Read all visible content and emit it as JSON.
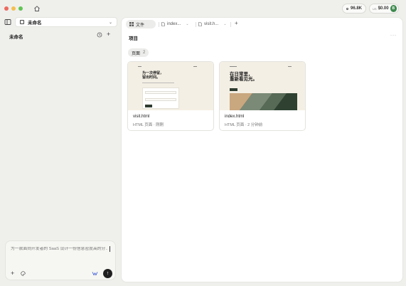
{
  "titlebar": {
    "github_stars": "96.8K",
    "cost": "$0.00",
    "cost_currency": "US",
    "avatar_initial": "B"
  },
  "sidebar": {
    "project_name": "未命名",
    "session_title": "未命名",
    "chat": {
      "placeholder": "为一款面向开发者的 SaaS 设计一份信息密度高的分..."
    }
  },
  "tabs": [
    {
      "label": "文件"
    },
    {
      "label": "index..."
    },
    {
      "label": "visit.h..."
    }
  ],
  "main": {
    "section_title": "项目",
    "filter": {
      "label": "页面",
      "count": "2"
    },
    "cards": [
      {
        "name": "visit.html",
        "meta": "HTML 页面 · 刚刚",
        "thumb_title_line1": "为一次停留，",
        "thumb_title_line2": "留出时间。"
      },
      {
        "name": "index.html",
        "meta": "HTML 页面 · 2 分钟前",
        "thumb_title_line1": "在日常里，",
        "thumb_title_line2": "重新看见光。"
      }
    ]
  },
  "colors": {
    "send_button": "#1f1f1f",
    "avatar": "#3f8a4f",
    "thumb_bg": "#f4efe4",
    "accent_green": "#2e3b2f"
  }
}
